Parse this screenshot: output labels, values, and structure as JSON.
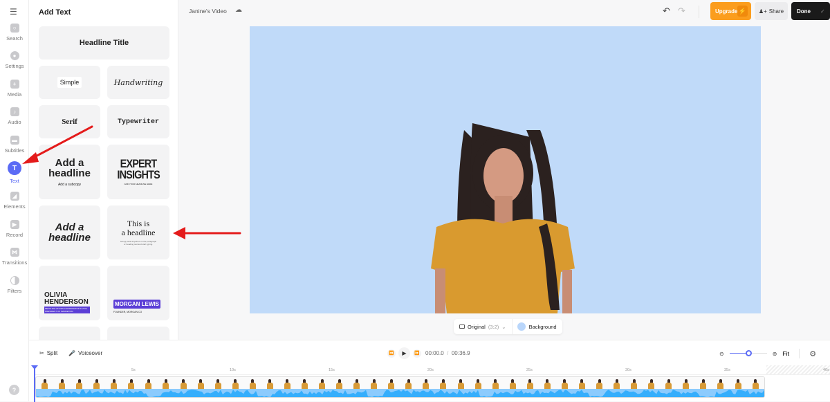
{
  "rail": {
    "items": [
      {
        "label": "Search",
        "icon": "search-icon"
      },
      {
        "label": "Settings",
        "icon": "gear-icon"
      },
      {
        "label": "Media",
        "icon": "plus-icon"
      },
      {
        "label": "Audio",
        "icon": "music-note-icon"
      },
      {
        "label": "Subtitles",
        "icon": "subtitles-icon"
      },
      {
        "label": "Text",
        "icon": "text-icon",
        "active": true
      },
      {
        "label": "Elements",
        "icon": "elements-icon"
      },
      {
        "label": "Record",
        "icon": "camera-icon"
      },
      {
        "label": "Transitions",
        "icon": "transitions-icon"
      },
      {
        "label": "Filters",
        "icon": "filters-icon"
      }
    ],
    "help": "?"
  },
  "panel": {
    "title": "Add Text",
    "headline_title": "Headline Title",
    "simple": "Simple",
    "handwriting": "Handwriting",
    "serif": "Serif",
    "typewriter": "Typewriter",
    "add_headline_1": "Add a headline",
    "add_subcopy": "Add a subcopy",
    "expert_1": "EXPERT",
    "expert_2": "INSIGHTS",
    "expert_sub": "ADD YOUR HEADLINE HERE",
    "add_headline_2": "Add a headline",
    "this_is_1": "This is",
    "this_is_2": "a headline",
    "this_is_sub": "Simply click anywhere in the paragraph or heading text and start typing.",
    "olivia_1": "OLIVIA",
    "olivia_2": "HENDERSON",
    "olivia_sub": "MEDIA RELATIONS COORDINATOR & VICE PRESIDENT OF MARKETING",
    "morgan": "MORGAN LEWIS",
    "morgan_sub": "FOUNDER, MORGAN CO"
  },
  "topbar": {
    "project_title": "Janine's Video",
    "upgrade": "Upgrade",
    "share": "Share",
    "done": "Done"
  },
  "canvas": {
    "background_color": "#c0daf9",
    "aspect_label": "Original",
    "aspect_ratio": "(3:2)",
    "background_label": "Background"
  },
  "timeline": {
    "split": "Split",
    "voiceover": "Voiceover",
    "current_time": "00:00.0",
    "separator": "/",
    "duration": "00:36.9",
    "fit": "Fit",
    "zoom_level": 0.5,
    "ticks": [
      "5s",
      "10s",
      "15s",
      "20s",
      "25s",
      "30s",
      "35s",
      "40s"
    ]
  }
}
